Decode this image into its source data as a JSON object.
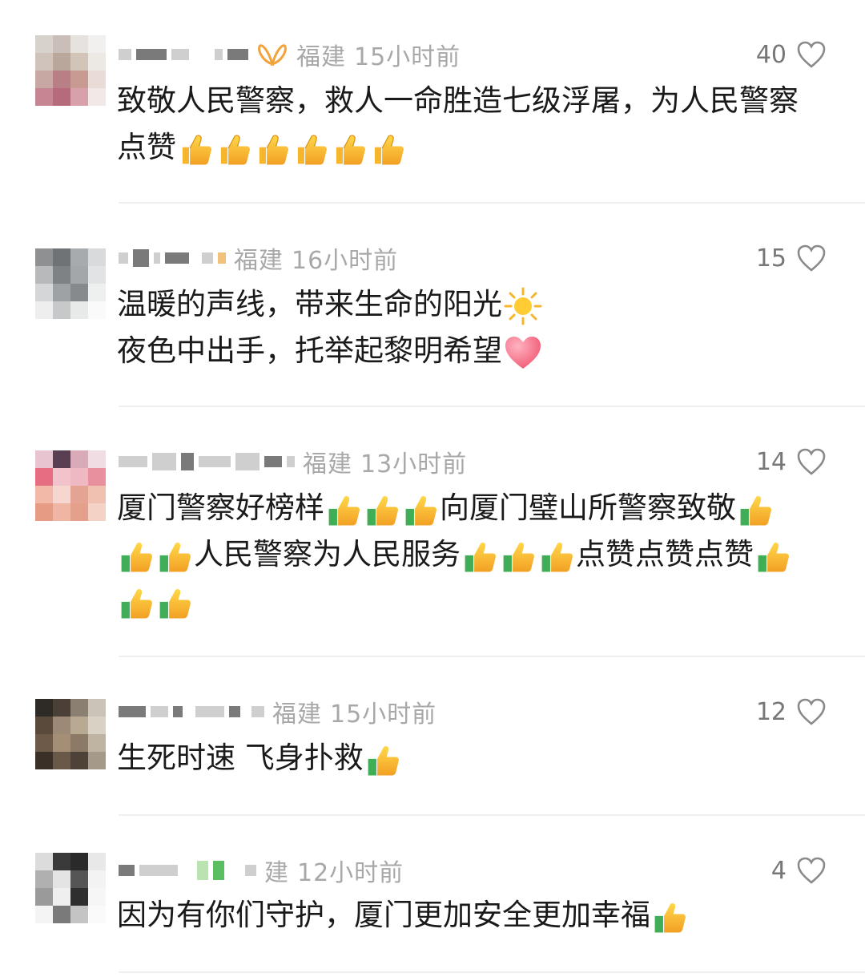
{
  "comments": [
    {
      "location": "福建",
      "time": "15小时前",
      "likes": "40",
      "badge": "vip-butterfly-icon",
      "text": "致敬人民警察，救人一命胜造七级浮屠，为人民警察点赞",
      "emojis": [
        "thumbs-up",
        "thumbs-up",
        "thumbs-up",
        "thumbs-up",
        "thumbs-up",
        "thumbs-up"
      ]
    },
    {
      "location": "福建",
      "time": "16小时前",
      "likes": "15",
      "line1": "温暖的声线，带来生命的阳光",
      "line2": "夜色中出手，托举起黎明希望"
    },
    {
      "location": "福建",
      "time": "13小时前",
      "likes": "14",
      "seg1": "厦门警察好榜样",
      "seg2": "向厦门璧山所警察致敬",
      "seg3": "人民警察为人民服务",
      "seg4": "点赞点赞点赞"
    },
    {
      "location": "福建",
      "time": "15小时前",
      "likes": "12",
      "text": "生死时速 飞身扑救"
    },
    {
      "location": "建",
      "time": "12小时前",
      "likes": "4",
      "text": "因为有你们守护，厦门更加安全更加幸福"
    }
  ],
  "colors": {
    "meta": "#a8a8a8",
    "text": "#1a1a1a",
    "divider": "#efefef",
    "vip": "#f2a33a"
  }
}
